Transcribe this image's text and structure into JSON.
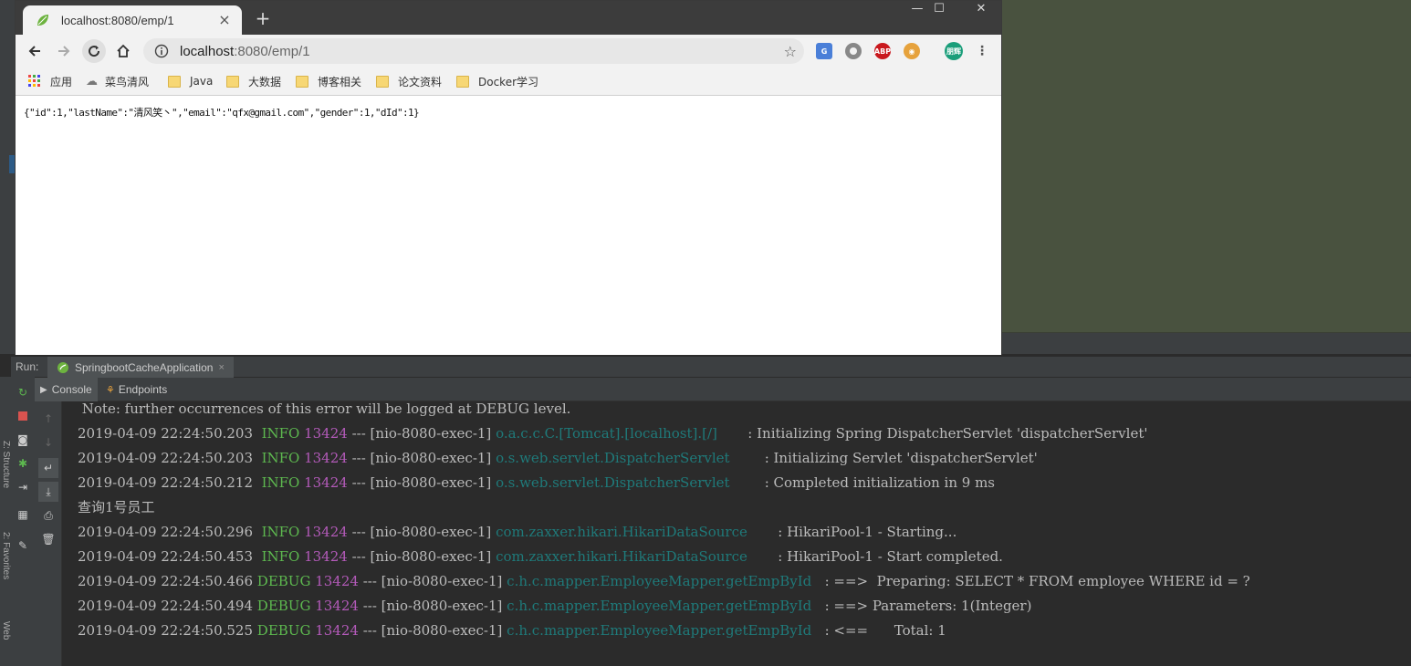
{
  "browser": {
    "tab_title": "localhost:8080/emp/1",
    "tab_close": "×",
    "new_tab": "+",
    "url_host": "localhost",
    "url_path": ":8080/emp/1",
    "window_controls": [
      "—",
      "☐",
      "✕"
    ],
    "bookmarks": [
      "应用",
      "菜鸟清风",
      "Java",
      "大数据",
      "博客相关",
      "论文资料",
      "Docker学习"
    ],
    "page_json": "{\"id\":1,\"lastName\":\"清风笑丶\",\"email\":\"qfx@gmail.com\",\"gender\":1,\"dId\":1}",
    "extension_labels": [
      "ABP",
      "朋辉"
    ]
  },
  "ide": {
    "run_label": "Run:",
    "run_tab": "SpringbootCacheApplication",
    "run_tab_close": "×",
    "subtabs": [
      "Console",
      "Endpoints"
    ],
    "side_labels": [
      "Z: Structure",
      "2: Favorites",
      "Web"
    ],
    "console_lines": [
      {
        "type": "plain",
        "text": " Note: further occurrences of this error will be logged at DEBUG level."
      },
      {
        "type": "log",
        "time": "2019-04-09 22:24:50.203",
        "level": " INFO",
        "pid": "13424",
        "thread": "--- [nio-8080-exec-1]",
        "logger": "o.a.c.c.C.[Tomcat].[localhost].[/]      ",
        "msg": ": Initializing Spring DispatcherServlet 'dispatcherServlet'"
      },
      {
        "type": "log",
        "time": "2019-04-09 22:24:50.203",
        "level": " INFO",
        "pid": "13424",
        "thread": "--- [nio-8080-exec-1]",
        "logger": "o.s.web.servlet.DispatcherServlet       ",
        "msg": ": Initializing Servlet 'dispatcherServlet'"
      },
      {
        "type": "log",
        "time": "2019-04-09 22:24:50.212",
        "level": " INFO",
        "pid": "13424",
        "thread": "--- [nio-8080-exec-1]",
        "logger": "o.s.web.servlet.DispatcherServlet       ",
        "msg": ": Completed initialization in 9 ms"
      },
      {
        "type": "plain",
        "text": "查询1号员工"
      },
      {
        "type": "log",
        "time": "2019-04-09 22:24:50.296",
        "level": " INFO",
        "pid": "13424",
        "thread": "--- [nio-8080-exec-1]",
        "logger": "com.zaxxer.hikari.HikariDataSource      ",
        "msg": ": HikariPool-1 - Starting..."
      },
      {
        "type": "log",
        "time": "2019-04-09 22:24:50.453",
        "level": " INFO",
        "pid": "13424",
        "thread": "--- [nio-8080-exec-1]",
        "logger": "com.zaxxer.hikari.HikariDataSource      ",
        "msg": ": HikariPool-1 - Start completed."
      },
      {
        "type": "log",
        "time": "2019-04-09 22:24:50.466",
        "level": "DEBUG",
        "pid": "13424",
        "thread": "--- [nio-8080-exec-1]",
        "logger": "c.h.c.mapper.EmployeeMapper.getEmpById  ",
        "msg": ": ==>  Preparing: SELECT * FROM employee WHERE id = ?"
      },
      {
        "type": "log",
        "time": "2019-04-09 22:24:50.494",
        "level": "DEBUG",
        "pid": "13424",
        "thread": "--- [nio-8080-exec-1]",
        "logger": "c.h.c.mapper.EmployeeMapper.getEmpById  ",
        "msg": ": ==> Parameters: 1(Integer)"
      },
      {
        "type": "log",
        "time": "2019-04-09 22:24:50.525",
        "level": "DEBUG",
        "pid": "13424",
        "thread": "--- [nio-8080-exec-1]",
        "logger": "c.h.c.mapper.EmployeeMapper.getEmpById  ",
        "msg": ": <==      Total: 1"
      }
    ]
  },
  "colors": {
    "info": "#5db84f",
    "pid": "#b35ab9",
    "logger": "#1f7a7a",
    "console_bg": "#2b2b2b",
    "editor_bg": "#49523f"
  }
}
